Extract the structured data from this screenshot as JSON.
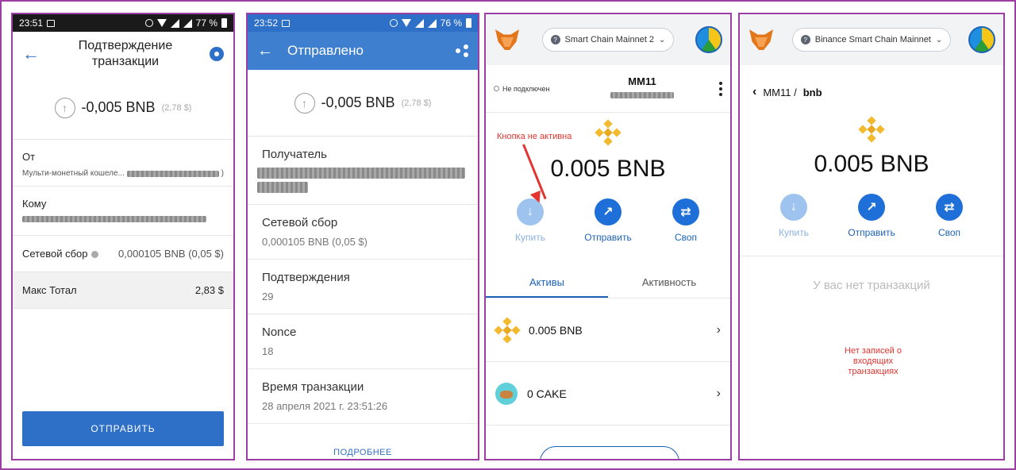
{
  "p1": {
    "status": {
      "time": "23:51",
      "battery": "77 %"
    },
    "title": "Подтверждение транзакции",
    "amount": "-0,005 BNB",
    "amount_fiat": "(2,78 $)",
    "from_label": "От",
    "from_value": "Мульти-монетный кошеле...",
    "from_paren": ")",
    "to_label": "Кому",
    "fee_label": "Сетевой сбор",
    "fee_value": "0,000105 BNB (0,05 $)",
    "max_label": "Макс Тотал",
    "max_value": "2,83 $",
    "send_button": "ОТПРАВИТЬ"
  },
  "p2": {
    "status": {
      "time": "23:52",
      "battery": "76 %"
    },
    "title": "Отправлено",
    "amount": "-0,005 BNB",
    "amount_fiat": "(2,78 $)",
    "recipient_label": "Получатель",
    "fee_label": "Сетевой сбор",
    "fee_value": "0,000105 BNB (0,05 $)",
    "confirm_label": "Подтверждения",
    "confirm_value": "29",
    "nonce_label": "Nonce",
    "nonce_value": "18",
    "time_label": "Время транзакции",
    "time_value": "28 апреля 2021 г. 23:51:26",
    "more": "ПОДРОБНЕЕ"
  },
  "p3": {
    "network": "Smart Chain Mainnet 2",
    "not_connected": "Не подключен",
    "account": "MM11",
    "annotation": "Кнопка не активна",
    "balance": "0.005 BNB",
    "actions": {
      "buy": "Купить",
      "send": "Отправить",
      "swap": "Своп"
    },
    "tabs": {
      "assets": "Активы",
      "activity": "Активность"
    },
    "assets": [
      {
        "name": "0.005 BNB"
      },
      {
        "name": "0 CAKE"
      }
    ]
  },
  "p4": {
    "network": "Binance Smart Chain Mainnet",
    "breadcrumb_account": "MM11 /",
    "breadcrumb_token": "bnb",
    "balance": "0.005 BNB",
    "actions": {
      "buy": "Купить",
      "send": "Отправить",
      "swap": "Своп"
    },
    "no_tx": "У вас нет транзакций",
    "no_incoming": "Нет записей о входящих транзакциях"
  },
  "colors": {
    "accent": "#2e6fc8",
    "frame": "#9b3fa5",
    "annotation": "#e3342f",
    "bnb": "#f3ba2f"
  }
}
